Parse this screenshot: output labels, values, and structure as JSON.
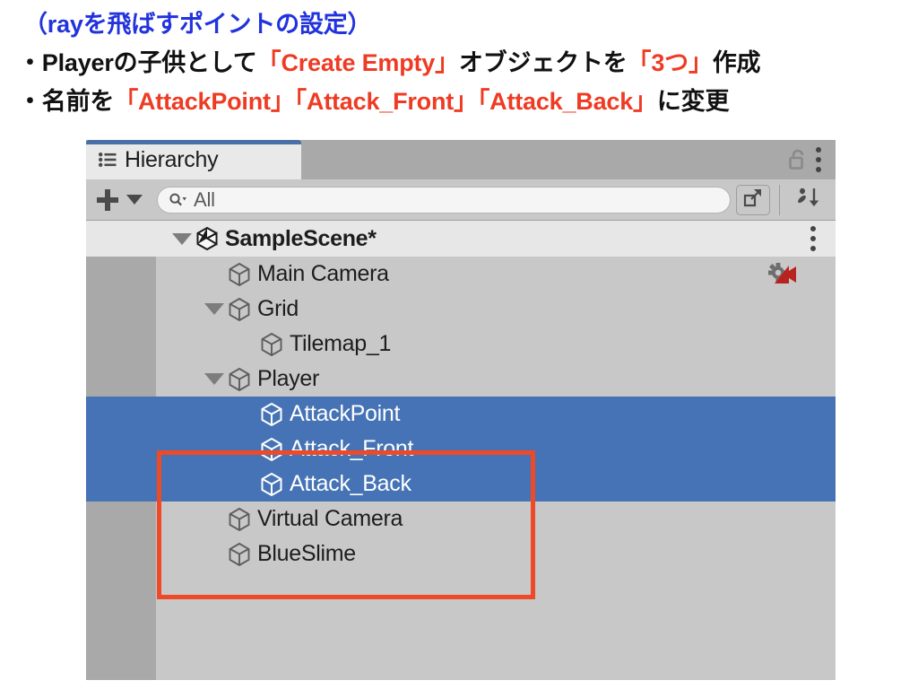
{
  "annotation": {
    "line1": "（rayを飛ばすポイントの設定）",
    "line2": {
      "seg1": "・Playerの子供として",
      "seg2": "「Create Empty」",
      "seg3": "オブジェクトを",
      "seg4": "「3つ」",
      "seg5": "作成"
    },
    "line3": {
      "seg1": "・名前を",
      "seg2": "「AttackPoint」",
      "seg3": "「Attack_Front」",
      "seg4": "「Attack_Back」",
      "seg5": "に変更"
    },
    "colors": {
      "heading_blue": "#2233dd",
      "emphasis_red": "#ef3b23",
      "body_black": "#111111"
    }
  },
  "window": {
    "tab": {
      "label": "Hierarchy",
      "icon": "hierarchy-list-icon",
      "accent_color": "#4a6fa8"
    },
    "header_controls": {
      "lock": "lock-open-icon",
      "menu": "kebab-menu-icon"
    },
    "toolbar": {
      "add_button": "plus-icon",
      "add_dropdown": "chevron-down-icon",
      "search": {
        "value": "",
        "placeholder": "All",
        "icon": "search-dropdown-icon"
      },
      "open_in_window_button": "open-in-new-window-icon",
      "sort_button": "alphabetical-sort-icon"
    },
    "tree": {
      "selection_color": "#4573b5",
      "highlight_box_color": "#ef4a28",
      "rows": [
        {
          "label": "SampleScene*",
          "depth": 0,
          "expanded": true,
          "icon": "unity-scene-icon",
          "selected": false,
          "scene": true,
          "kebab": true
        },
        {
          "label": "Main Camera",
          "depth": 1,
          "expanded": null,
          "icon": "gameobject-cube-icon",
          "selected": false,
          "badge": "cinemachine-camera-icon"
        },
        {
          "label": "Grid",
          "depth": 1,
          "expanded": true,
          "icon": "gameobject-cube-icon",
          "selected": false
        },
        {
          "label": "Tilemap_1",
          "depth": 2,
          "expanded": null,
          "icon": "gameobject-cube-icon",
          "selected": false
        },
        {
          "label": "Player",
          "depth": 1,
          "expanded": true,
          "icon": "gameobject-cube-icon",
          "selected": false
        },
        {
          "label": "AttackPoint",
          "depth": 2,
          "expanded": null,
          "icon": "gameobject-cube-icon",
          "selected": true
        },
        {
          "label": "Attack_Front",
          "depth": 2,
          "expanded": null,
          "icon": "gameobject-cube-icon",
          "selected": true
        },
        {
          "label": "Attack_Back",
          "depth": 2,
          "expanded": null,
          "icon": "gameobject-cube-icon",
          "selected": true
        },
        {
          "label": "Virtual Camera",
          "depth": 1,
          "expanded": null,
          "icon": "gameobject-cube-icon",
          "selected": false
        },
        {
          "label": "BlueSlime",
          "depth": 1,
          "expanded": null,
          "icon": "gameobject-cube-icon",
          "selected": false
        }
      ]
    }
  }
}
